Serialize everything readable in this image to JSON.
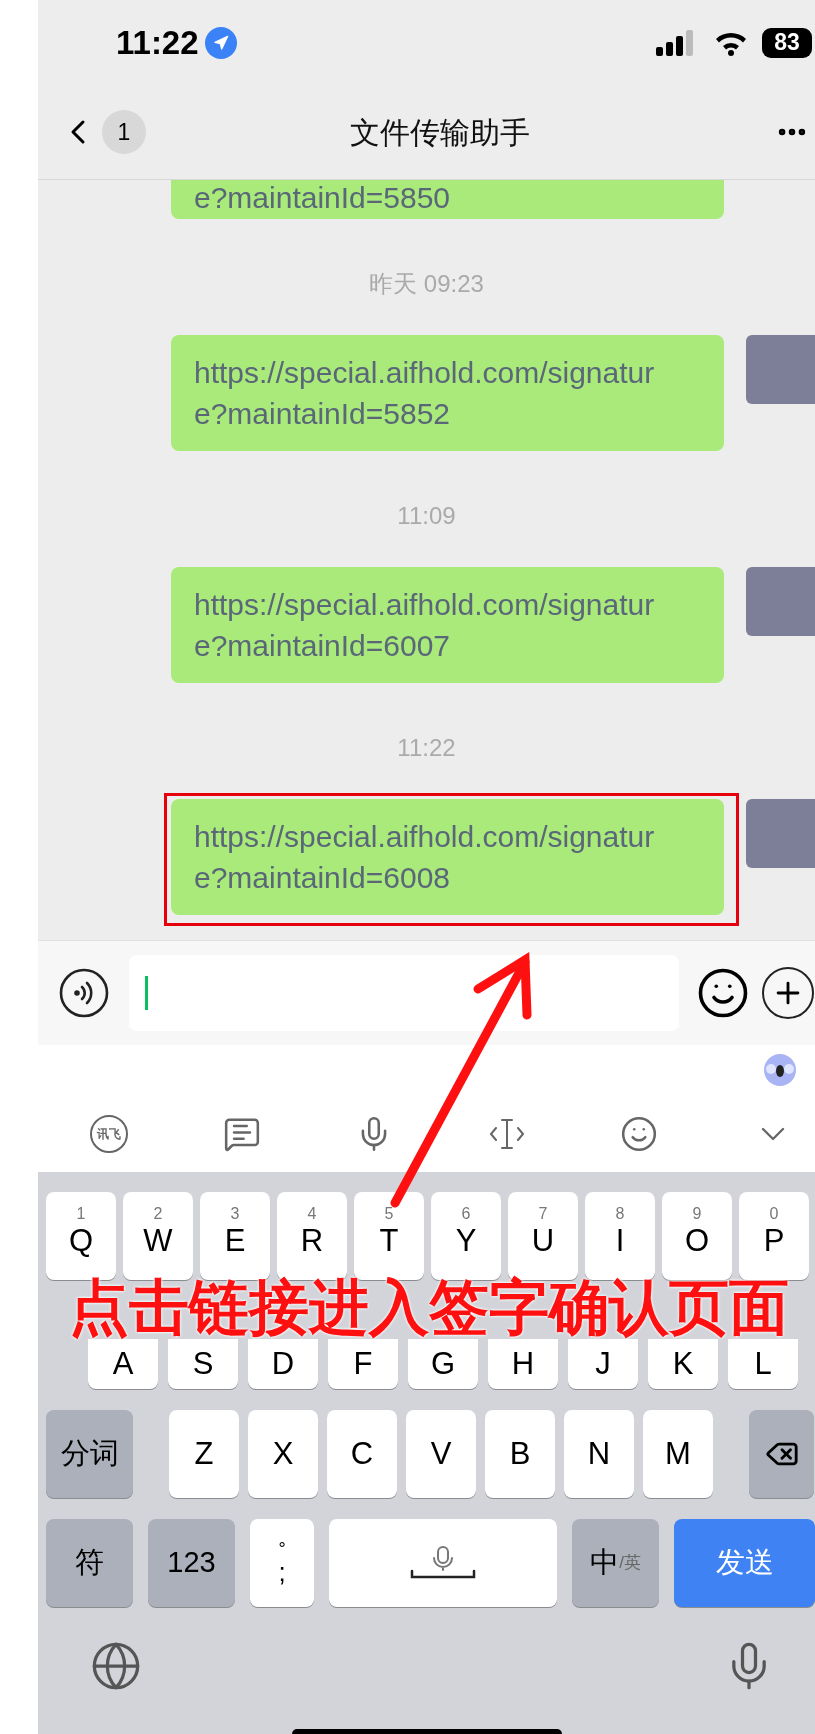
{
  "status_bar": {
    "time": "11:22",
    "battery": "83"
  },
  "nav": {
    "back_count": "1",
    "title": "文件传输助手"
  },
  "messages": [
    {
      "kind": "partial",
      "text": "e?maintainId=5850",
      "annotated": false
    },
    {
      "kind": "time",
      "text": "昨天 09:23"
    },
    {
      "kind": "bubble",
      "text": "https://special.aifhold.com/signature?maintainId=5852",
      "annotated": false
    },
    {
      "kind": "time",
      "text": "11:09"
    },
    {
      "kind": "bubble",
      "text": "https://special.aifhold.com/signature?maintainId=6007",
      "annotated": false
    },
    {
      "kind": "time",
      "text": "11:22"
    },
    {
      "kind": "bubble",
      "text": "https://special.aifhold.com/signature?maintainId=6008",
      "annotated": true
    }
  ],
  "toolbar": {
    "logo_text": "讯飞"
  },
  "keyboard": [
    {
      "keys": [
        {
          "kind": "letter",
          "label": "Q",
          "hint": "1"
        },
        {
          "kind": "letter",
          "label": "W",
          "hint": "2"
        },
        {
          "kind": "letter",
          "label": "E",
          "hint": "3"
        },
        {
          "kind": "letter",
          "label": "R",
          "hint": "4"
        },
        {
          "kind": "letter",
          "label": "T",
          "hint": "5"
        },
        {
          "kind": "letter",
          "label": "Y",
          "hint": "6"
        },
        {
          "kind": "letter",
          "label": "U",
          "hint": "7"
        },
        {
          "kind": "letter",
          "label": "I",
          "hint": "8"
        },
        {
          "kind": "letter",
          "label": "O",
          "hint": "9"
        },
        {
          "kind": "letter",
          "label": "P",
          "hint": "0"
        }
      ]
    },
    {
      "keys": [
        {
          "kind": "letter",
          "label": "A"
        },
        {
          "kind": "letter",
          "label": "S"
        },
        {
          "kind": "letter",
          "label": "D"
        },
        {
          "kind": "letter",
          "label": "F"
        },
        {
          "kind": "letter",
          "label": "G"
        },
        {
          "kind": "letter",
          "label": "H"
        },
        {
          "kind": "letter",
          "label": "J"
        },
        {
          "kind": "letter",
          "label": "K"
        },
        {
          "kind": "letter",
          "label": "L"
        }
      ]
    },
    {
      "keys": [
        {
          "kind": "function",
          "label": "分词"
        },
        {
          "kind": "letter",
          "label": "Z"
        },
        {
          "kind": "letter",
          "label": "X"
        },
        {
          "kind": "letter",
          "label": "C"
        },
        {
          "kind": "letter",
          "label": "V"
        },
        {
          "kind": "letter",
          "label": "B"
        },
        {
          "kind": "letter",
          "label": "N"
        },
        {
          "kind": "letter",
          "label": "M"
        },
        {
          "kind": "backspace"
        }
      ]
    },
    {
      "keys": [
        {
          "kind": "function",
          "label": "符"
        },
        {
          "kind": "function",
          "label": "123"
        },
        {
          "kind": "punct",
          "label": ";",
          "hint": "°"
        },
        {
          "kind": "space"
        },
        {
          "kind": "lang",
          "label": "中",
          "sub": "/英"
        },
        {
          "kind": "send",
          "label": "发送"
        }
      ]
    }
  ],
  "annotation": {
    "text": "点击链接进入签字确认页面"
  }
}
